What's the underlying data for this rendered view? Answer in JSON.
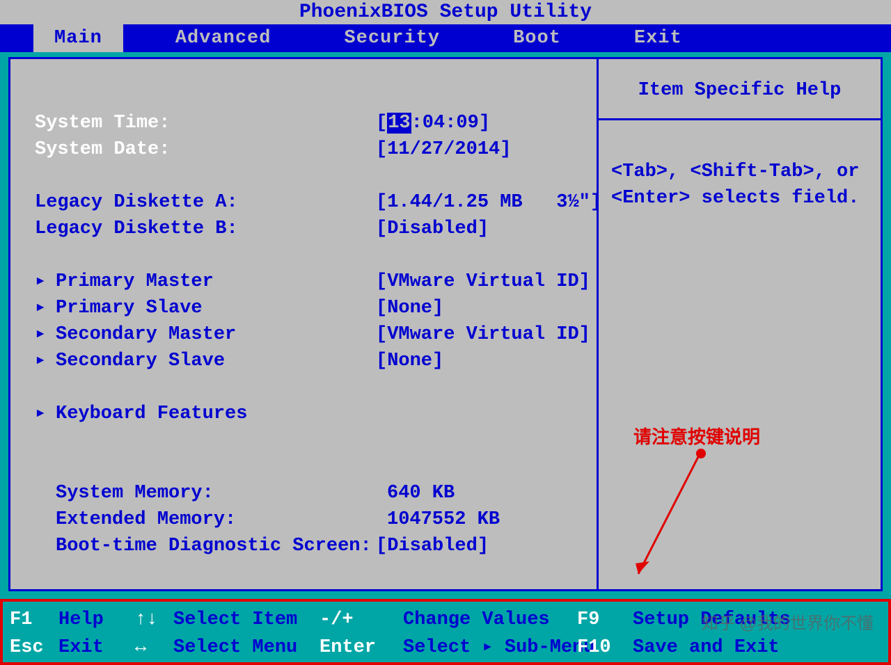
{
  "title": "PhoenixBIOS Setup Utility",
  "menu": [
    "Main",
    "Advanced",
    "Security",
    "Boot",
    "Exit"
  ],
  "active_tab": "Main",
  "fields": {
    "system_time_label": "System Time:",
    "system_time_hh": "13",
    "system_time_rest": ":04:09",
    "system_date_label": "System Date:",
    "system_date_value": "11/27/2014",
    "legacy_a_label": "Legacy Diskette A:",
    "legacy_a_value": "1.44/1.25 MB   3½\"",
    "legacy_b_label": "Legacy Diskette B:",
    "legacy_b_value": "Disabled",
    "pri_master_label": "Primary Master",
    "pri_master_value": "VMware Virtual ID",
    "pri_slave_label": "Primary Slave",
    "pri_slave_value": "None",
    "sec_master_label": "Secondary Master",
    "sec_master_value": "VMware Virtual ID",
    "sec_slave_label": "Secondary Slave",
    "sec_slave_value": "None",
    "kbd_label": "Keyboard Features",
    "sys_mem_label": "System Memory:",
    "sys_mem_value": "640 KB",
    "ext_mem_label": "Extended Memory:",
    "ext_mem_value": "1047552 KB",
    "boot_diag_label": "Boot-time Diagnostic Screen:",
    "boot_diag_value": "Disabled"
  },
  "help": {
    "title": "Item Specific Help",
    "body1": "<Tab>, <Shift-Tab>, or",
    "body2": "<Enter> selects field."
  },
  "footer": {
    "f1": "F1",
    "help": "Help",
    "updown": "↑↓",
    "select_item": "Select Item",
    "pm": "-/+",
    "change_values": "Change Values",
    "f9": "F9",
    "setup_defaults": "Setup Defaults",
    "esc": "Esc",
    "exit": "Exit",
    "lr": "↔",
    "select_menu": "Select Menu",
    "enter": "Enter",
    "select_sub": "Select",
    "tri": "▸",
    "sub_menu": "Sub-Menu",
    "f10": "F10",
    "save_exit": "Save and Exit"
  },
  "annotation": "请注意按键说明",
  "watermark": "知乎 @我的世界你不懂"
}
